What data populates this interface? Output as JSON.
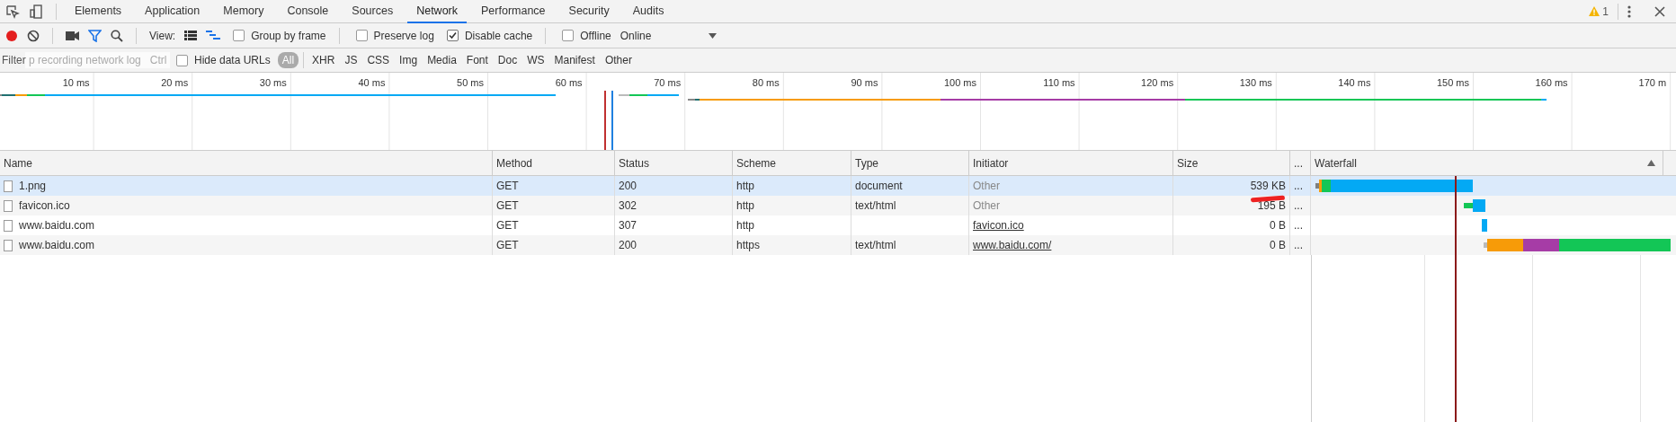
{
  "tabs": [
    {
      "label": "Elements",
      "selected": false
    },
    {
      "label": "Application",
      "selected": false
    },
    {
      "label": "Memory",
      "selected": false
    },
    {
      "label": "Console",
      "selected": false
    },
    {
      "label": "Sources",
      "selected": false
    },
    {
      "label": "Network",
      "selected": true
    },
    {
      "label": "Performance",
      "selected": false
    },
    {
      "label": "Security",
      "selected": false
    },
    {
      "label": "Audits",
      "selected": false
    }
  ],
  "warning_count": "1",
  "toolbar": {
    "recording": true,
    "filter_on": true,
    "view_label": "View:",
    "large_rows": false,
    "overview_on": true,
    "checkboxes": [
      {
        "label": "Group by frame",
        "checked": false
      },
      {
        "label": "Preserve log",
        "checked": false
      },
      {
        "label": "Disable cache",
        "checked": true
      },
      {
        "label": "Offline",
        "checked": false
      }
    ],
    "throttling": "Online"
  },
  "filter_bar": {
    "placeholder": "Filter",
    "tooltip": "p recording network log",
    "tooltip_shortcut": "Ctrl",
    "hide_data_urls": {
      "label": "Hide data URLs",
      "checked": false
    },
    "types": [
      {
        "label": "All",
        "selected": true
      },
      {
        "label": "XHR",
        "selected": false
      },
      {
        "label": "JS",
        "selected": false
      },
      {
        "label": "CSS",
        "selected": false
      },
      {
        "label": "Img",
        "selected": false
      },
      {
        "label": "Media",
        "selected": false
      },
      {
        "label": "Font",
        "selected": false
      },
      {
        "label": "Doc",
        "selected": false
      },
      {
        "label": "WS",
        "selected": false
      },
      {
        "label": "Manifest",
        "selected": false
      },
      {
        "label": "Other",
        "selected": false
      }
    ]
  },
  "overview": {
    "ticks": [
      "10 ms",
      "20 ms",
      "30 ms",
      "40 ms",
      "50 ms",
      "60 ms",
      "70 ms",
      "80 ms",
      "90 ms",
      "100 ms",
      "110 ms",
      "120 ms",
      "130 ms",
      "140 ms",
      "150 ms",
      "160 ms",
      "170 m"
    ]
  },
  "table": {
    "columns": [
      "Name",
      "Method",
      "Status",
      "Scheme",
      "Type",
      "Initiator",
      "Size",
      "...",
      "Waterfall"
    ],
    "rows": [
      {
        "name": "1.png",
        "method": "GET",
        "status": "200",
        "scheme": "http",
        "type": "document",
        "initiator": {
          "text": "Other",
          "kind": "plain"
        },
        "size": "539 KB",
        "more": "...",
        "selected": true
      },
      {
        "name": "favicon.ico",
        "method": "GET",
        "status": "302",
        "scheme": "http",
        "type": "text/html",
        "initiator": {
          "text": "Other",
          "kind": "plain"
        },
        "size": "195 B",
        "more": "...",
        "selected": false
      },
      {
        "name": "www.baidu.com",
        "method": "GET",
        "status": "307",
        "scheme": "http",
        "type": "",
        "initiator": {
          "text": "favicon.ico",
          "kind": "link"
        },
        "size": "0 B",
        "more": "...",
        "selected": false
      },
      {
        "name": "www.baidu.com",
        "method": "GET",
        "status": "200",
        "scheme": "https",
        "type": "text/html",
        "initiator": {
          "text": "www.baidu.com/",
          "kind": "link"
        },
        "size": "0 B",
        "more": "...",
        "selected": false
      }
    ]
  }
}
